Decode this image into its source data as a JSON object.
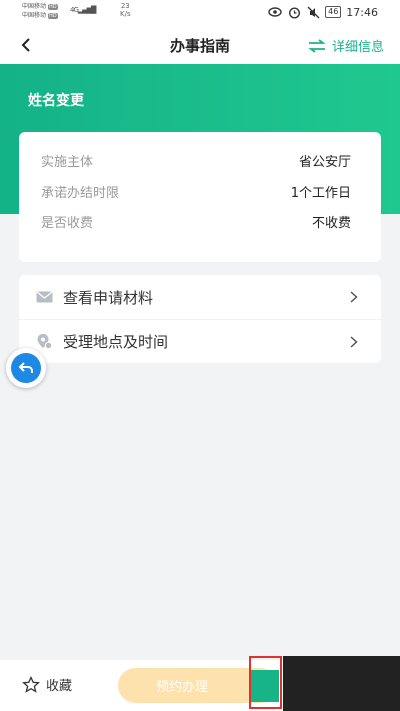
{
  "status_bar": {
    "carrier_1": "中国移动",
    "carrier_1_badge": "HD",
    "carrier_2": "中国移动",
    "carrier_2_badge": "HD",
    "net_type": "4G",
    "speed_value": "23",
    "speed_unit": "K/s",
    "battery": "46",
    "time": "17:46"
  },
  "nav": {
    "title": "办事指南",
    "detail_label": "详细信息"
  },
  "banner": {
    "title": "姓名变更"
  },
  "info": {
    "rows": [
      {
        "label": "实施主体",
        "value": "省公安厅"
      },
      {
        "label": "承诺办结时限",
        "value": "1个工作日"
      },
      {
        "label": "是否收费",
        "value": "不收费"
      }
    ]
  },
  "links": [
    {
      "label": "查看申请材料",
      "icon": "mail-icon"
    },
    {
      "label": "受理地点及时间",
      "icon": "location-icon"
    }
  ],
  "bottom": {
    "favorite_label": "收藏",
    "book_label": "预约办理"
  },
  "colors": {
    "accent": "#1ab38a",
    "banner_start": "#14b287",
    "banner_end": "#1fc88f",
    "book_button": "#fde2ae",
    "float_button": "#1e88e5",
    "highlight_box": "#e03030"
  }
}
